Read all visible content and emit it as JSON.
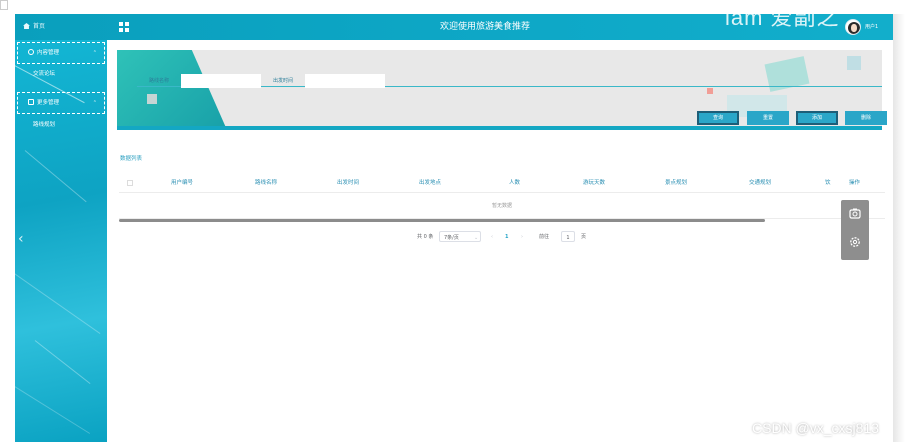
{
  "header": {
    "home_label": "首页",
    "title": "欢迎使用旅游美食推荐",
    "logo_text": "iam 爱副之",
    "user_name": "用户1"
  },
  "sidebar": {
    "groups": [
      {
        "label": "内容管理",
        "items": [
          {
            "label": "交流论坛"
          }
        ]
      },
      {
        "label": "更多管理",
        "items": [
          {
            "label": "路线规划"
          }
        ]
      }
    ]
  },
  "search": {
    "route_name_label": "路线名称",
    "route_name_value": "",
    "depart_time_label": "出发时间",
    "depart_time_value": ""
  },
  "actions": {
    "query": "查询",
    "reset": "重置",
    "add": "添加",
    "delete": "删除"
  },
  "list": {
    "title": "数据列表",
    "columns": [
      "用户编号",
      "路线名称",
      "出发时间",
      "出发地点",
      "人数",
      "游玩天数",
      "景点规划",
      "交通规划",
      "饮",
      "操作"
    ],
    "rows": [],
    "empty_text": "暂无数据"
  },
  "pagination": {
    "total_text": "共 0 条",
    "page_size": "7条/页",
    "prev": "‹",
    "current_page": "1",
    "next": "›",
    "goto_label": "前往",
    "goto_value": "1",
    "page_unit": "页"
  },
  "watermark": "CSDN @vx_cxsj813",
  "colors": {
    "header_bg": "#0ea8c7",
    "sidebar_bg": "#13b6d4",
    "accent": "#2aa6c8",
    "column_text": "#2a8fb3"
  }
}
